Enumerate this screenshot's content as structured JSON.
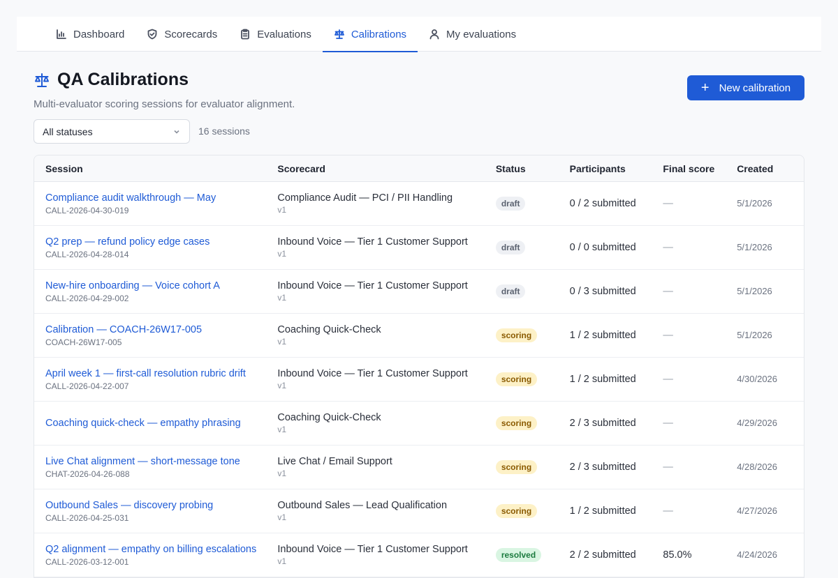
{
  "nav": {
    "tabs": [
      {
        "label": "Dashboard",
        "icon": "bar-chart-icon"
      },
      {
        "label": "Scorecards",
        "icon": "shield-check-icon"
      },
      {
        "label": "Evaluations",
        "icon": "clipboard-icon"
      },
      {
        "label": "Calibrations",
        "icon": "scale-icon",
        "active": true
      },
      {
        "label": "My evaluations",
        "icon": "user-icon"
      }
    ]
  },
  "header": {
    "title": "QA Calibrations",
    "subtitle": "Multi-evaluator scoring sessions for evaluator alignment.",
    "new_button": "New calibration",
    "plus": "+"
  },
  "filter": {
    "status_value": "All statuses",
    "count": "16 sessions"
  },
  "table": {
    "headers": {
      "session": "Session",
      "scorecard": "Scorecard",
      "status": "Status",
      "participants": "Participants",
      "final_score": "Final score",
      "created": "Created"
    },
    "rows": [
      {
        "title": "Compliance audit walkthrough — May",
        "id": "CALL-2026-04-30-019",
        "scorecard": "Compliance Audit — PCI / PII Handling",
        "version": "v1",
        "status": "draft",
        "participants": "0 / 2 submitted",
        "final": "—",
        "created": "5/1/2026"
      },
      {
        "title": "Q2 prep — refund policy edge cases",
        "id": "CALL-2026-04-28-014",
        "scorecard": "Inbound Voice — Tier 1 Customer Support",
        "version": "v1",
        "status": "draft",
        "participants": "0 / 0 submitted",
        "final": "—",
        "created": "5/1/2026"
      },
      {
        "title": "New-hire onboarding — Voice cohort A",
        "id": "CALL-2026-04-29-002",
        "scorecard": "Inbound Voice — Tier 1 Customer Support",
        "version": "v1",
        "status": "draft",
        "participants": "0 / 3 submitted",
        "final": "—",
        "created": "5/1/2026"
      },
      {
        "title": "Calibration — COACH-26W17-005",
        "id": "COACH-26W17-005",
        "scorecard": "Coaching Quick-Check",
        "version": "v1",
        "status": "scoring",
        "participants": "1 / 2 submitted",
        "final": "—",
        "created": "5/1/2026"
      },
      {
        "title": "April week 1 — first-call resolution rubric drift",
        "id": "CALL-2026-04-22-007",
        "scorecard": "Inbound Voice — Tier 1 Customer Support",
        "version": "v1",
        "status": "scoring",
        "participants": "1 / 2 submitted",
        "final": "—",
        "created": "4/30/2026"
      },
      {
        "title": "Coaching quick-check — empathy phrasing",
        "id": "",
        "scorecard": "Coaching Quick-Check",
        "version": "v1",
        "status": "scoring",
        "participants": "2 / 3 submitted",
        "final": "—",
        "created": "4/29/2026"
      },
      {
        "title": "Live Chat alignment — short-message tone",
        "id": "CHAT-2026-04-26-088",
        "scorecard": "Live Chat / Email Support",
        "version": "v1",
        "status": "scoring",
        "participants": "2 / 3 submitted",
        "final": "—",
        "created": "4/28/2026"
      },
      {
        "title": "Outbound Sales — discovery probing",
        "id": "CALL-2026-04-25-031",
        "scorecard": "Outbound Sales — Lead Qualification",
        "version": "v1",
        "status": "scoring",
        "participants": "1 / 2 submitted",
        "final": "—",
        "created": "4/27/2026"
      },
      {
        "title": "Q2 alignment — empathy on billing escalations",
        "id": "CALL-2026-03-12-001",
        "scorecard": "Inbound Voice — Tier 1 Customer Support",
        "version": "v1",
        "status": "resolved",
        "participants": "2 / 2 submitted",
        "final": "85.0%",
        "created": "4/24/2026"
      }
    ]
  }
}
